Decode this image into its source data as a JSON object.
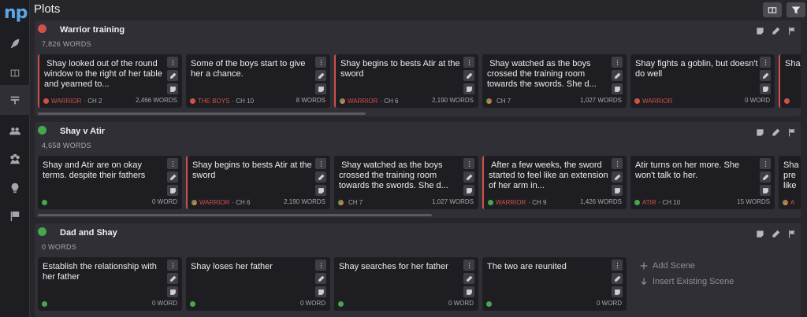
{
  "app": {
    "logo": "np",
    "title": "Plots"
  },
  "sidebar": {
    "items": [
      {
        "icon": "feather-icon"
      },
      {
        "icon": "book-icon"
      },
      {
        "icon": "plots-icon",
        "active": true
      },
      {
        "icon": "characters-icon"
      },
      {
        "icon": "locations-icon"
      },
      {
        "icon": "ideas-icon"
      },
      {
        "icon": "flags-icon"
      }
    ]
  },
  "toolbar": {
    "view_icon": "columns-icon",
    "filter_icon": "filter-icon"
  },
  "colors": {
    "red": "#d0504a",
    "green": "#45a84a",
    "pink": "#e05a6a",
    "orange": "#c98a3c"
  },
  "plots": [
    {
      "title": "Warrior training",
      "words": "7,826 WORDS",
      "status": "red",
      "cards": [
        {
          "text": " Shay looked out of the round window to the right of her table and yearned to...",
          "tag": "WARRIOR",
          "ch": " · CH 2",
          "words": "2,466 WORDS",
          "dot": "red",
          "border": true
        },
        {
          "text": "Some of the boys start to give her a chance.",
          "tag": "THE BOYS",
          "ch": " · CH 10",
          "words": "8 WORDS",
          "dot": "red",
          "border": false
        },
        {
          "text": "Shay begins to bests Atir at the sword",
          "tag": "WARRIOR",
          "ch": " · CH 6",
          "words": "2,190 WORDS",
          "dot": "multi",
          "border": true
        },
        {
          "text": " Shay watched as the boys crossed the training room towards the swords. She d...",
          "tag": "",
          "ch": "CH 7",
          "words": "1,027 WORDS",
          "dot": "multi",
          "border": false
        },
        {
          "text": "Shay fights a goblin, but doesn't do well",
          "tag": "WARRIOR",
          "ch": "",
          "words": "0 WORD",
          "dot": "red",
          "border": false
        },
        {
          "text": "Sha",
          "tag": "",
          "ch": "",
          "words": "",
          "dot": "red",
          "border": true
        }
      ]
    },
    {
      "title": "Shay v Atir",
      "words": "4,658 WORDS",
      "status": "green",
      "cards": [
        {
          "text": "Shay and Atir are on okay terms. despite their fathers",
          "tag": "",
          "ch": "",
          "words": "0 WORD",
          "dot": "green",
          "border": false
        },
        {
          "text": "Shay begins to bests Atir at the sword",
          "tag": "WARRIOR",
          "ch": " · CH 6",
          "words": "2,190 WORDS",
          "dot": "multi",
          "border": true
        },
        {
          "text": " Shay watched as the boys crossed the training room towards the swords. She d...",
          "tag": "",
          "ch": "CH 7",
          "words": "1,027 WORDS",
          "dot": "multi",
          "border": false
        },
        {
          "text": " After a few weeks, the sword started to feel like an extension of her arm in...",
          "tag": "WARRIOR",
          "ch": " · CH 9",
          "words": "1,426 WORDS",
          "dot": "green",
          "border": true
        },
        {
          "text": "Atir turns on her more. She won't talk to her.",
          "tag": "ATIR",
          "ch": " · CH 10",
          "words": "15 WORDS",
          "dot": "green",
          "border": false
        },
        {
          "text": "Sha\npre\nlike",
          "tag": "A",
          "ch": "",
          "words": "",
          "dot": "multi",
          "border": false
        }
      ]
    },
    {
      "title": "Dad and Shay",
      "words": "0 WORDS",
      "status": "green",
      "cards": [
        {
          "text": "Establish the relationship with her father",
          "tag": "",
          "ch": "",
          "words": "0 WORD",
          "dot": "green",
          "border": false
        },
        {
          "text": "Shay loses her father",
          "tag": "",
          "ch": "",
          "words": "0 WORD",
          "dot": "green",
          "border": false
        },
        {
          "text": "Shay searches for her father",
          "tag": "",
          "ch": "",
          "words": "0 WORD",
          "dot": "green",
          "border": false
        },
        {
          "text": "The two are reunited",
          "tag": "",
          "ch": "",
          "words": "0 WORD",
          "dot": "green",
          "border": false
        }
      ],
      "add_scene": "Add Scene",
      "insert_scene": "Insert Existing Scene"
    }
  ]
}
